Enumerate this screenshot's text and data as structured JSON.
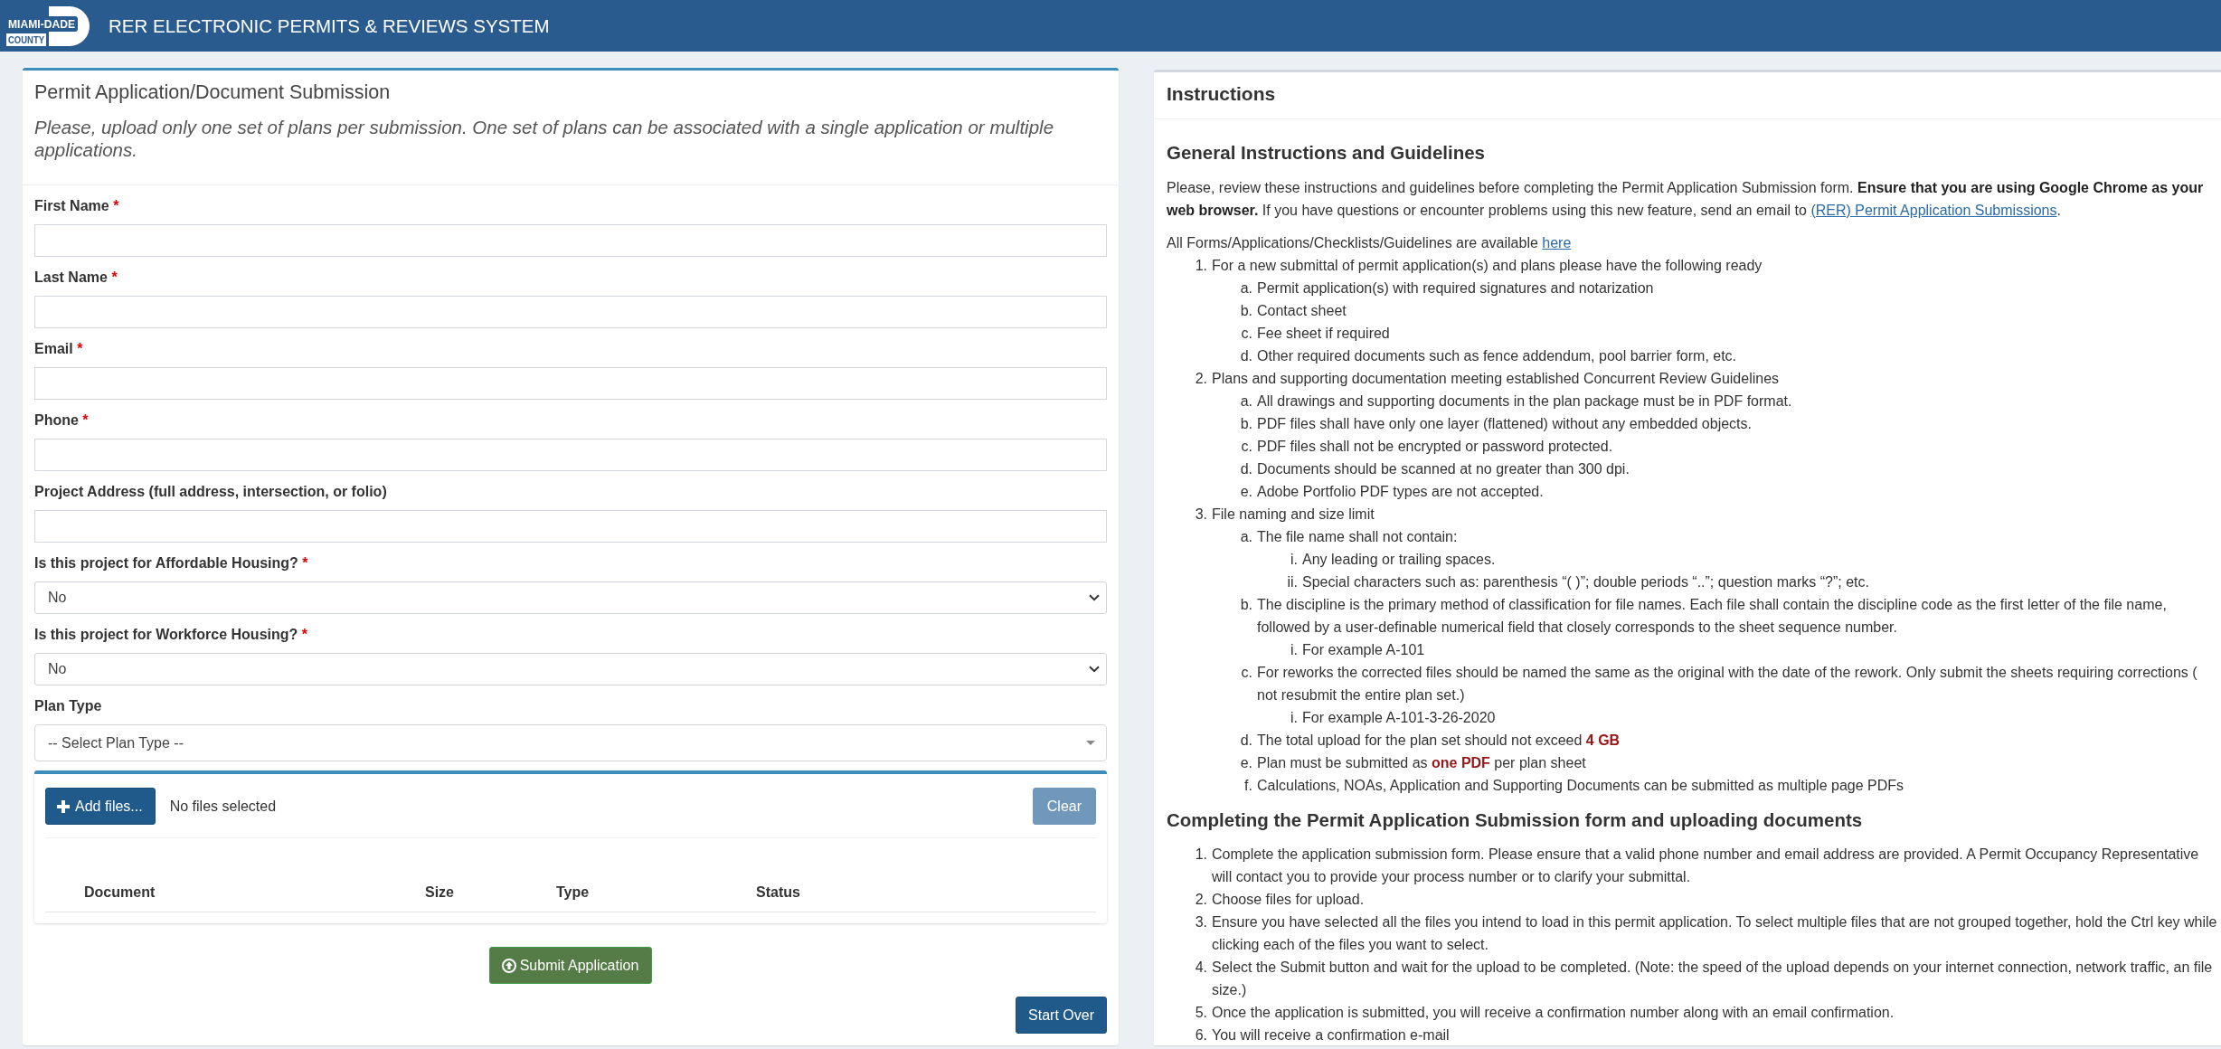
{
  "header": {
    "logo": {
      "line_1": "MIAMI-DADE",
      "line_2": "COUNTY"
    },
    "title": "RER ELECTRONIC PERMITS & REVIEWS SYSTEM"
  },
  "form_panel": {
    "title": "Permit Application/Document Submission",
    "subtitle": "Please, upload only one set of plans per submission. One set of plans can be associated with a single application or multiple applications.",
    "fields": [
      {
        "kind": "text",
        "label": "First Name",
        "required_mark": "*"
      },
      {
        "kind": "text",
        "label": "Last Name",
        "required_mark": "*"
      },
      {
        "kind": "text",
        "label": "Email",
        "required_mark": "*"
      },
      {
        "kind": "text",
        "label": "Phone",
        "required_mark": "*"
      },
      {
        "kind": "text",
        "label": "Project Address (full address, intersection, or folio)"
      },
      {
        "kind": "select",
        "label": "Is this project for Affordable Housing?",
        "required_mark": "*",
        "value": "No"
      },
      {
        "kind": "select",
        "label": "Is this project for Workforce Housing?",
        "required_mark": "*",
        "value": "No"
      },
      {
        "kind": "combo",
        "label": "Plan Type",
        "placeholder": "-- Select Plan Type --"
      }
    ],
    "upload": {
      "add_button": "Add files...",
      "status": "No files selected",
      "clear_button": {
        "label": "Clear",
        "disabled": true
      },
      "columns": [
        "Document",
        "Size",
        "Type",
        "Status"
      ]
    },
    "submit_button": "Submit Application",
    "start_over_button": "Start Over"
  },
  "instructions_panel": {
    "title": "Instructions",
    "sections": [
      {
        "heading": "General Instructions and Guidelines",
        "paragraphs": [
          {
            "text": "Please, review these instructions and guidelines before completing the Permit Application Submission form. **Ensure that you are using Google Chrome as your web browser.** If you have questions or encounter problems using this new feature, send an email to",
            "link": "(RER) Permit Application Submissions",
            "after": "."
          },
          {
            "text": "All Forms/Applications/Checklists/Guidelines are available",
            "link": "here"
          }
        ],
        "list": [
          {
            "marker": "1.",
            "text": "For a new submittal of permit application(s) and plans please have the following ready",
            "children": [
              {
                "marker": "a.",
                "text": "Permit application(s) with required signatures and notarization"
              },
              {
                "marker": "b.",
                "text": "Contact sheet"
              },
              {
                "marker": "c.",
                "text": "Fee sheet if required"
              },
              {
                "marker": "d.",
                "text": "Other required documents such as fence addendum, pool barrier form, etc."
              }
            ]
          },
          {
            "marker": "2.",
            "text": "Plans and supporting documentation meeting established Concurrent Review Guidelines",
            "children": [
              {
                "marker": "a.",
                "text": "All drawings and supporting documents in the plan package must be in PDF format."
              },
              {
                "marker": "b.",
                "text": "PDF files shall have only one layer (flattened) without any embedded objects."
              },
              {
                "marker": "c.",
                "text": "PDF files shall not be encrypted or password protected."
              },
              {
                "marker": "d.",
                "text": "Documents should be scanned at no greater than 300 dpi."
              },
              {
                "marker": "e.",
                "text": "Adobe Portfolio PDF types are not accepted."
              }
            ]
          },
          {
            "marker": "3.",
            "text": "File naming and size limit",
            "children": [
              {
                "marker": "a.",
                "text": "The file name shall not contain:",
                "children": [
                  {
                    "marker": "i.",
                    "text": "Any leading or trailing spaces."
                  },
                  {
                    "marker": "ii.",
                    "text": "Special characters such as: parenthesis “( )”; double periods “..”; question marks “?”; etc."
                  }
                ]
              },
              {
                "marker": "b.",
                "text": "The discipline is the primary method of classification for file names. Each file shall contain the discipline code as the first letter of the file name, followed by a user-definable numerical field that closely corresponds to the sheet sequence number.",
                "children": [
                  {
                    "marker": "i.",
                    "text": "For example A-101"
                  }
                ]
              },
              {
                "marker": "c.",
                "text": "For reworks the corrected files should be named the same as the original with the date of the rework. Only submit the sheets requiring corrections ( not resubmit the entire plan set.)",
                "children": [
                  {
                    "marker": "i.",
                    "text": "For example A-101-3-26-2020"
                  }
                ]
              },
              {
                "marker": "d.",
                "text": "The total upload for the plan set should not exceed **4 GB**"
              },
              {
                "marker": "e.",
                "text": "Plan must be submitted as **one PDF** per plan sheet"
              },
              {
                "marker": "f.",
                "text": "Calculations, NOAs, Application and Supporting Documents can be submitted as multiple page PDFs"
              }
            ]
          }
        ]
      },
      {
        "heading": "Completing the Permit Application Submission form and uploading documents",
        "list": [
          {
            "marker": "1.",
            "text": "Complete the application submission form. Please ensure that a valid phone number and email address are provided. A Permit Occupancy Representative will contact you to provide your process number or to clarify your submittal."
          },
          {
            "marker": "2.",
            "text": "Choose files for upload."
          },
          {
            "marker": "3.",
            "text": "Ensure you have selected all the files you intend to load in this permit application. To select multiple files that are not grouped together, hold the Ctrl key while clicking each of the files you want to select."
          },
          {
            "marker": "4.",
            "text": "Select the Submit button and wait for the upload to be completed. (Note: the speed of the upload depends on your internet connection, network traffic, an file size.)"
          },
          {
            "marker": "5.",
            "text": "Once the application is submitted, you will receive a confirmation number along with an email confirmation."
          },
          {
            "marker": "6.",
            "text": "You will receive a confirmation e-mail"
          }
        ]
      }
    ]
  }
}
